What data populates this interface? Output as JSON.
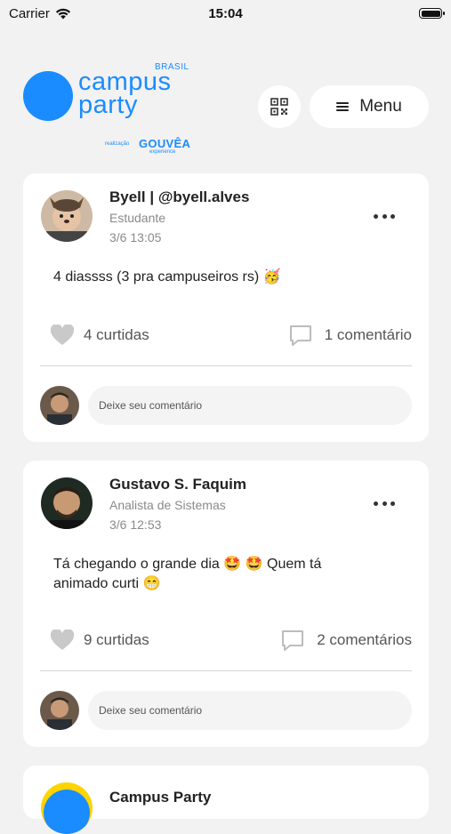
{
  "status_bar": {
    "carrier": "Carrier",
    "time": "15:04"
  },
  "header": {
    "logo": {
      "country": "BRASIL",
      "line1": "campus",
      "line2": "party",
      "realizacao": "realização",
      "partner": "GOUVÊA",
      "partner_sub": "experience"
    },
    "qr_icon": "qr-code-icon",
    "menu_label": "Menu"
  },
  "posts": [
    {
      "author": "Byell | @byell.alves",
      "role": "Estudante",
      "time": "3/6 13:05",
      "text": "4 diassss (3 pra campuseiros rs) 🥳",
      "likes": "4 curtidas",
      "comments": "1 comentário",
      "comment_placeholder": "Deixe seu comentário"
    },
    {
      "author": "Gustavo S. Faquim",
      "role": "Analista de Sistemas",
      "time": "3/6 12:53",
      "text": "Tá chegando o grande dia 🤩 🤩  Quem tá animado curti 😁",
      "likes": "9 curtidas",
      "comments": "2 comentários",
      "comment_placeholder": "Deixe seu comentário"
    },
    {
      "author": "Campus Party"
    }
  ],
  "colors": {
    "brand": "#1a8cff",
    "background": "#f2f2f2",
    "card": "#ffffff"
  }
}
